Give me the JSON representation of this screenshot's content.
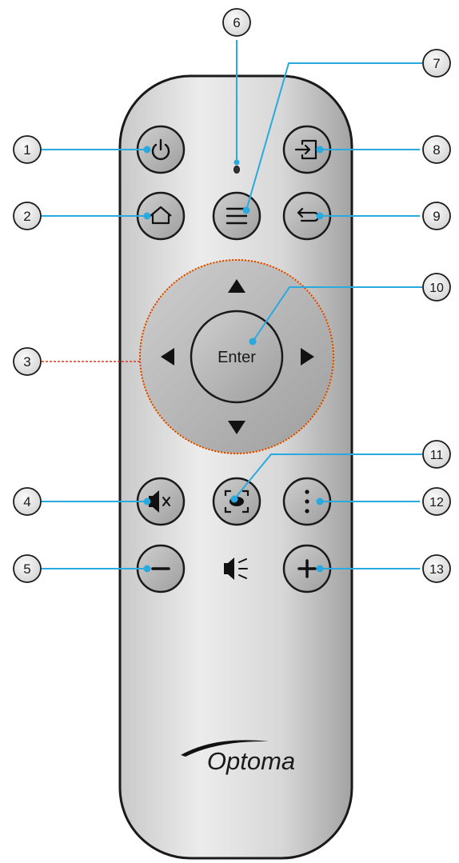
{
  "remote": {
    "brand": "Optoma",
    "enter_label": "Enter",
    "colors": {
      "body_light": "#e9e9e9",
      "body_dark": "#9a9a9a",
      "outline": "#1a1a1a",
      "leader": "#29a9e0",
      "callout_fill": "#e6e6e6",
      "highlight": "#d63b1f"
    }
  },
  "callouts": [
    {
      "n": "1"
    },
    {
      "n": "2"
    },
    {
      "n": "3"
    },
    {
      "n": "4"
    },
    {
      "n": "5"
    },
    {
      "n": "6"
    },
    {
      "n": "7"
    },
    {
      "n": "8"
    },
    {
      "n": "9"
    },
    {
      "n": "10"
    },
    {
      "n": "11"
    },
    {
      "n": "12"
    },
    {
      "n": "13"
    }
  ]
}
